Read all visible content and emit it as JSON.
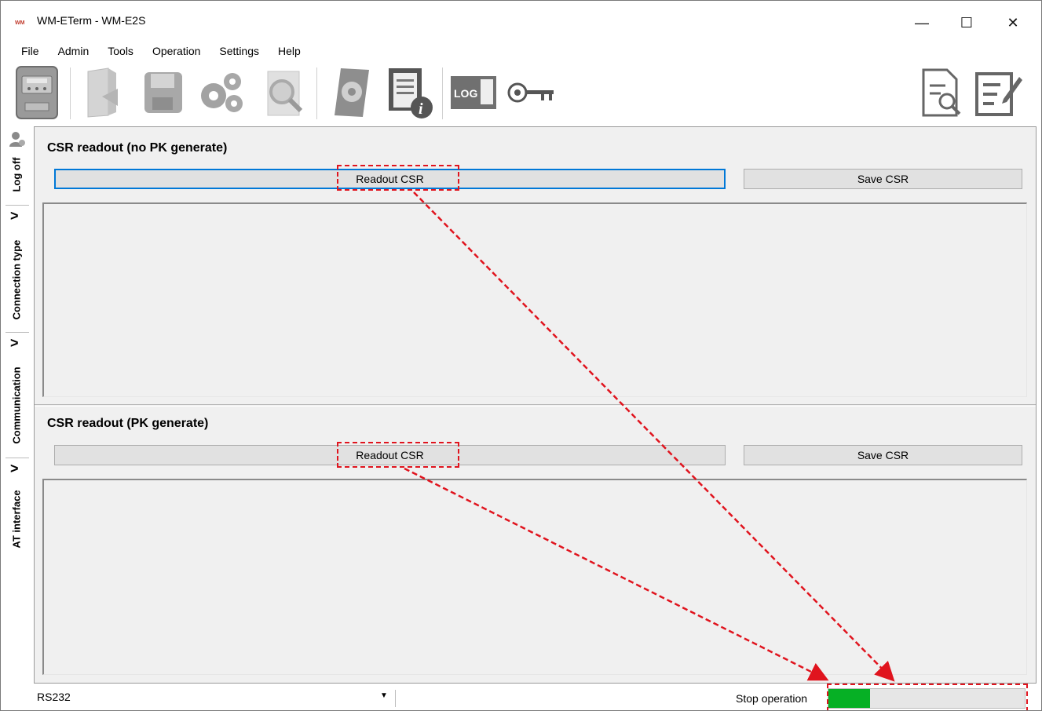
{
  "window": {
    "title": "WM-ETerm - WM-E2S",
    "logo_text": "WM",
    "controls": {
      "minimize": "—",
      "maximize": "☐",
      "close": "✕"
    }
  },
  "menu": [
    "File",
    "Admin",
    "Tools",
    "Operation",
    "Settings",
    "Help"
  ],
  "toolbar": {
    "items": [
      "meter-icon",
      "open-folder-icon",
      "save-disk-icon",
      "gears-icon",
      "search-document-icon",
      "settings-book-icon",
      "document-info-icon",
      "log-icon",
      "key-refresh-icon",
      "report-search-icon",
      "edit-document-icon"
    ],
    "log_text": "LOG"
  },
  "side_tabs": [
    "Log off",
    "Connection type",
    "Communication",
    "AT interface"
  ],
  "sections": [
    {
      "title": "CSR readout (no PK generate)",
      "readout_label": "Readout CSR",
      "save_label": "Save CSR"
    },
    {
      "title": "CSR readout (PK generate)",
      "readout_label": "Readout CSR",
      "save_label": "Save CSR"
    }
  ],
  "status": {
    "connection": "RS232",
    "stop_label": "Stop operation",
    "progress_fraction": 0.21,
    "progress_color": "#06b025"
  },
  "annotation_color": "#e0141e"
}
